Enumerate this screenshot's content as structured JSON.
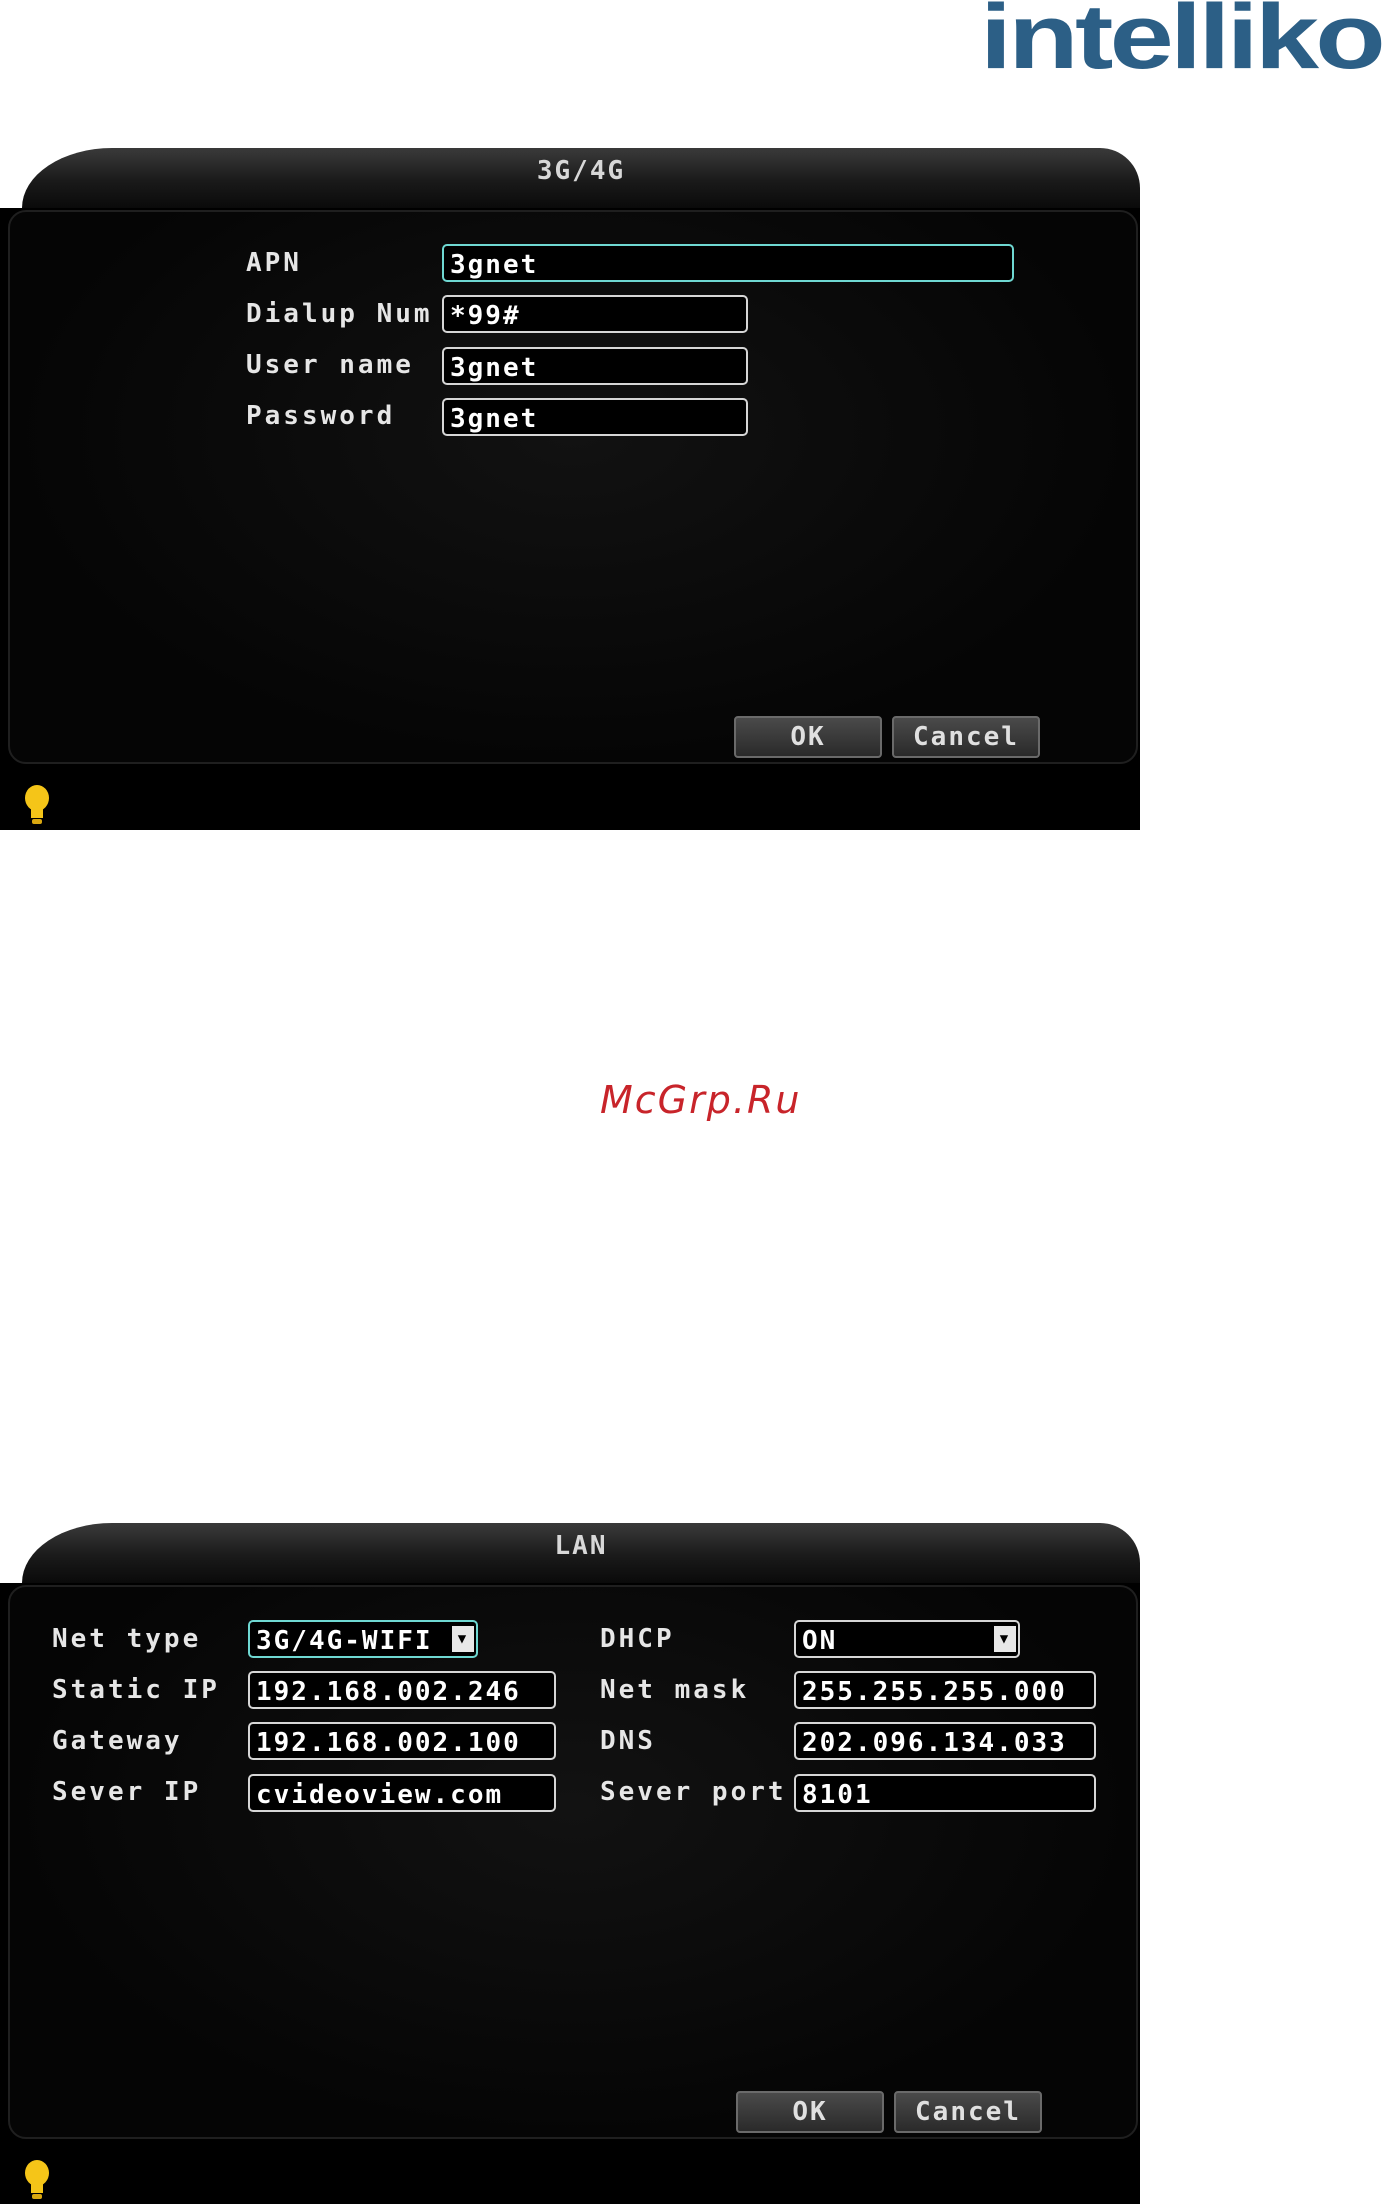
{
  "brand": {
    "logo_text": "intelliko"
  },
  "watermark": {
    "text": "McGrp.Ru"
  },
  "panel_3g4g": {
    "title": "3G/4G",
    "fields": [
      {
        "label": "APN",
        "value": "3gnet"
      },
      {
        "label": "Dialup Num",
        "value": "*99#"
      },
      {
        "label": "User name",
        "value": "3gnet"
      },
      {
        "label": "Password",
        "value": "3gnet"
      }
    ],
    "ok_label": "OK",
    "cancel_label": "Cancel"
  },
  "panel_lan": {
    "title": "LAN",
    "left_fields": [
      {
        "label": "Net type",
        "value": "3G/4G-WIFI"
      },
      {
        "label": "Static IP",
        "value": "192.168.002.246"
      },
      {
        "label": "Gateway",
        "value": "192.168.002.100"
      },
      {
        "label": "Sever IP",
        "value": "cvideoview.com"
      }
    ],
    "right_fields": [
      {
        "label": "DHCP",
        "value": "ON"
      },
      {
        "label": "Net mask",
        "value": "255.255.255.000"
      },
      {
        "label": "DNS",
        "value": "202.096.134.033"
      },
      {
        "label": "Sever port",
        "value": "8101"
      }
    ],
    "ok_label": "OK",
    "cancel_label": "Cancel"
  },
  "colors": {
    "active_border": "#6fd8d2",
    "logo_blue": "#2c5f86",
    "watermark_red": "#c8242a"
  }
}
